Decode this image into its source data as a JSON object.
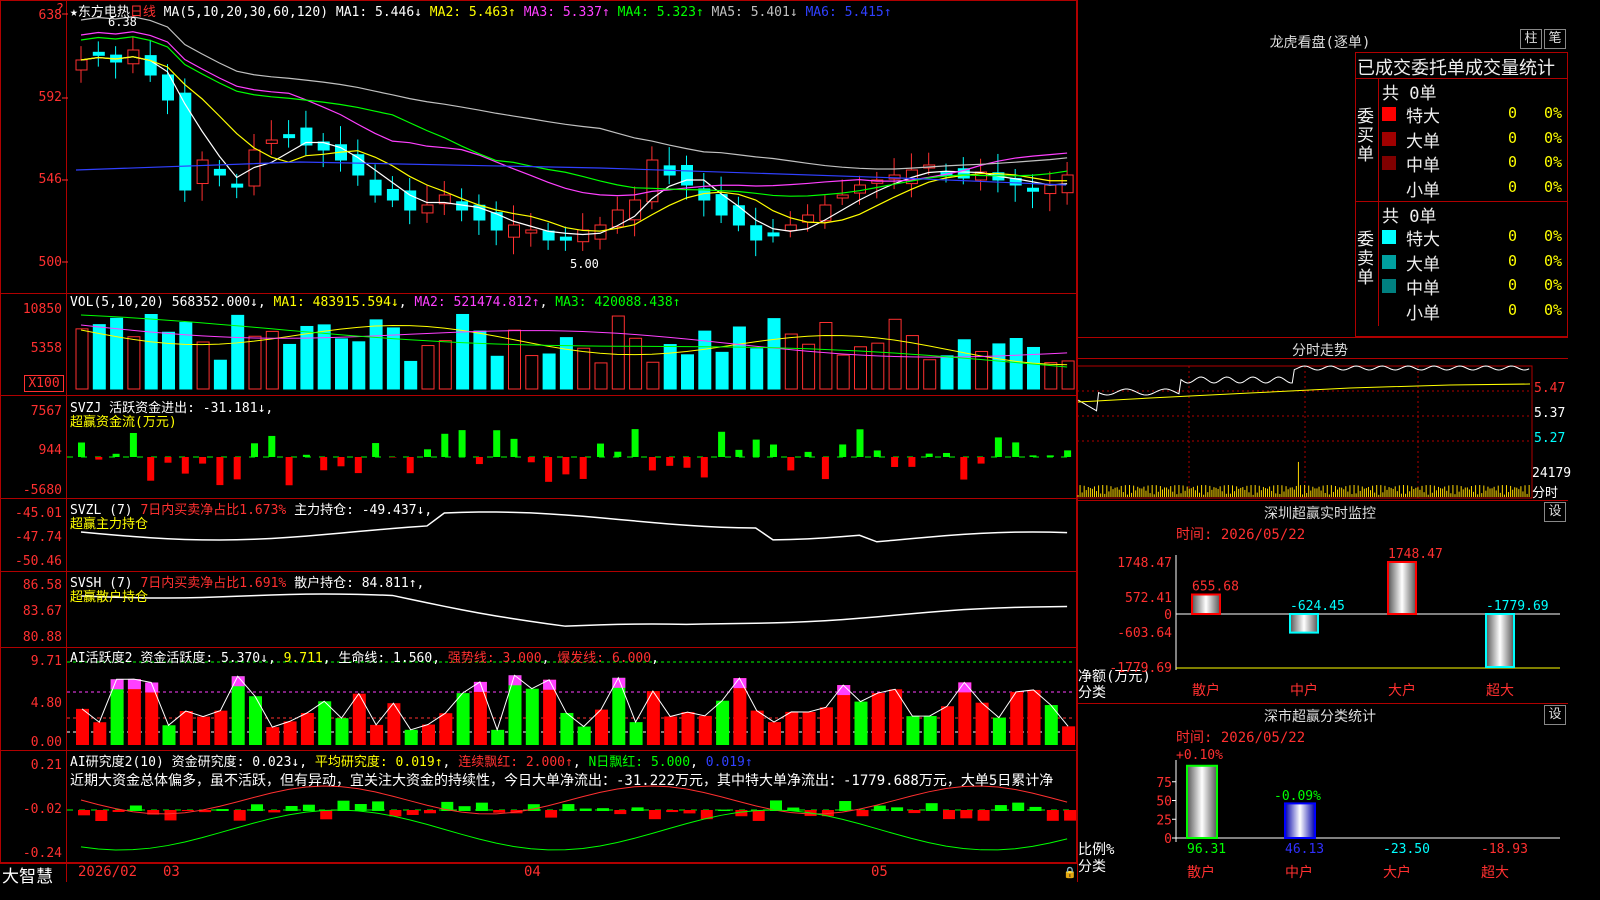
{
  "main_chart": {
    "title": "★东方电热",
    "period": "日线",
    "ma_label": "MA(5,10,20,30,60,120)",
    "ma": [
      {
        "name": "MA1:",
        "value": "5.446↓",
        "color": "#ffffff"
      },
      {
        "name": "MA2:",
        "value": "5.463↑",
        "color": "#ffff00"
      },
      {
        "name": "MA3:",
        "value": "5.337↑",
        "color": "#ff40ff"
      },
      {
        "name": "MA4:",
        "value": "5.323↑",
        "color": "#00ff00"
      },
      {
        "name": "MA5:",
        "value": "5.401↓",
        "color": "#c0c0c0"
      },
      {
        "name": "MA6:",
        "value": "5.415↑",
        "color": "#3040ff"
      }
    ],
    "y_ticks": [
      "638",
      "592",
      "546",
      "500"
    ],
    "high_label": "6.38",
    "low_label": "5.00"
  },
  "vol_panel": {
    "label": "VOL(5,10,20)",
    "value": "568352.000↓",
    "ma1": "MA1: 483915.594↓",
    "ma2": "MA2: 521474.812↑",
    "ma3": "MA3: 420088.438↑",
    "y_ticks": [
      "10850",
      "5358"
    ],
    "unit": "X100"
  },
  "svzj_panel": {
    "label": "SVZJ",
    "text": "活跃资金进出: -31.181↓",
    "subtitle": "超赢资金流(万元)",
    "y_ticks": [
      "7567",
      "944",
      "-5680"
    ]
  },
  "svzl_panel": {
    "label": "SVZL (7)",
    "ratio": "7日内买卖净占比1.673%",
    "hold": "主力持仓: -49.437↓",
    "subtitle": "超赢主力持仓",
    "y_ticks": [
      "-45.01",
      "-47.74",
      "-50.46"
    ]
  },
  "svsh_panel": {
    "label": "SVSH (7)",
    "ratio": "7日内买卖净占比1.691%",
    "hold": "散户持仓: 84.811↑",
    "subtitle": "超赢散户持仓",
    "y_ticks": [
      "86.58",
      "83.67",
      "80.88"
    ]
  },
  "ai_active_panel": {
    "label": "AI活跃度2",
    "activity": "资金活跃度: 5.370↓",
    "v2": "9.711",
    "life": "生命线: 1.560",
    "strong": "强势线: 3.000",
    "burst": "爆发线: 6.000",
    "y_ticks": [
      "9.71",
      "4.80",
      "0.00"
    ]
  },
  "ai_research_panel": {
    "label": "AI研究度2(10)",
    "research": "资金研究度: 0.023↓",
    "avg": "平均研究度: 0.019↑",
    "streak": "连续飘红: 2.000↑",
    "nday": "N日飘红: 5.000",
    "extra": "0.019↑",
    "comment": "近期大资金总体偏多，虽不活跃，但有异动，宜关注大资金的持续性，今日大单净流出：-31.222万元，其中特大单净流出：-1779.688万元，大单5日累计净",
    "y_ticks": [
      "0.21",
      "-0.02",
      "-0.24"
    ]
  },
  "bottom_axis": {
    "brand": "大智慧",
    "dates": [
      "2026/02",
      "03",
      "04",
      "05"
    ]
  },
  "dragon_tiger": {
    "title": "龙虎看盘(逐单)",
    "btn1": "柱",
    "btn2": "笔",
    "header": "已成交委托单成交量统计",
    "buy_label": "委买单",
    "sell_label": "委卖单",
    "buy_total": "共 0单",
    "sell_total": "共 0单",
    "buy_rows": [
      {
        "name": "特大",
        "count": "0",
        "pct": "0%",
        "color": "#ff0000"
      },
      {
        "name": "大单",
        "count": "0",
        "pct": "0%",
        "color": "#a00000"
      },
      {
        "name": "中单",
        "count": "0",
        "pct": "0%",
        "color": "#800000"
      },
      {
        "name": "小单",
        "count": "0",
        "pct": "0%",
        "color": ""
      }
    ],
    "sell_rows": [
      {
        "name": "特大",
        "count": "0",
        "pct": "0%",
        "color": "#00ffff"
      },
      {
        "name": "大单",
        "count": "0",
        "pct": "0%",
        "color": "#00a0a0"
      },
      {
        "name": "中单",
        "count": "0",
        "pct": "0%",
        "color": "#008080"
      },
      {
        "name": "小单",
        "count": "0",
        "pct": "0%",
        "color": ""
      }
    ]
  },
  "intraday": {
    "title": "分时走势",
    "y_ticks": [
      "5.47",
      "5.37",
      "5.27"
    ],
    "vol_tick": "24179",
    "vol_unit": "分时"
  },
  "realtime_monitor": {
    "title": "深圳超赢实时监控",
    "set": "设",
    "time": "时间: 2026/05/22",
    "y_ticks": [
      "1748.47",
      "572.41",
      "0",
      "-603.64",
      "-1779.69"
    ],
    "ylabel": "净额(万元)",
    "xlabel": "分类",
    "chart_data": {
      "type": "bar",
      "categories": [
        "散户",
        "中户",
        "大户",
        "超大"
      ],
      "values": [
        655.68,
        -624.45,
        1748.47,
        -1779.69
      ],
      "ylim": [
        -1779.69,
        1748.47
      ]
    }
  },
  "classification": {
    "title": "深市超赢分类统计",
    "set": "设",
    "time": "时间: 2026/05/22",
    "ylabel": "比例%",
    "xlabel": "分类",
    "y_ticks": [
      "75",
      "50",
      "25",
      "0"
    ],
    "top_labels": [
      "+0.10%",
      "-0.09%"
    ],
    "chart_data": {
      "type": "bar",
      "categories": [
        "散户",
        "中户",
        "大户",
        "超大"
      ],
      "values": [
        96.31,
        46.13,
        -23.5,
        -18.93
      ],
      "ylim": [
        0,
        100
      ]
    }
  }
}
